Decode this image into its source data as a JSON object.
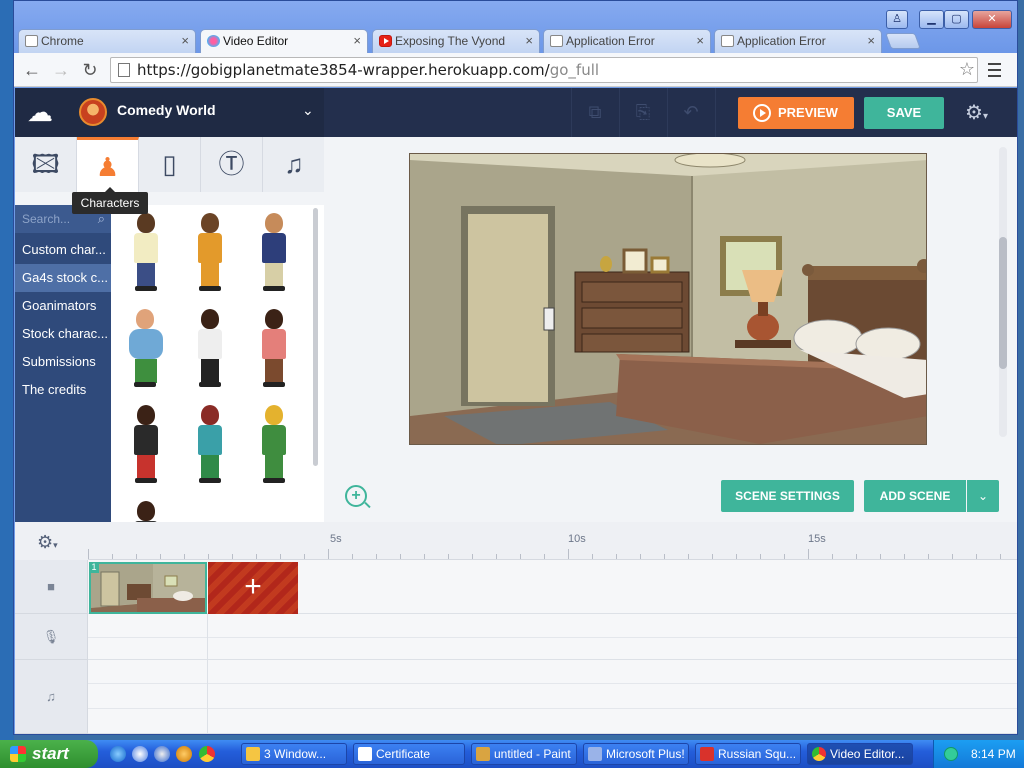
{
  "window_controls": {
    "user": "♙",
    "minimize": "▁",
    "maximize": "▢",
    "close": "✕"
  },
  "tabs": [
    {
      "label": "Chrome",
      "icon": "page-icon"
    },
    {
      "label": "Video Editor",
      "icon": "vyond-icon",
      "active": true
    },
    {
      "label": "Exposing The Vyond",
      "icon": "youtube-icon"
    },
    {
      "label": "Application Error",
      "icon": "page-icon"
    },
    {
      "label": "Application Error",
      "icon": "page-icon"
    }
  ],
  "tab_close": "×",
  "toolbar": {
    "back": "←",
    "forward": "→",
    "reload": "↻",
    "url_main": "https://gobigplanetmate3854-wrapper.herokuapp.com/",
    "url_dim": "go_full",
    "star": "☆"
  },
  "editor": {
    "upload_icon": "☁",
    "theme_name": "Comedy World",
    "theme_chevron": "⌄",
    "header_icons": [
      "⧉",
      "⎘",
      "↶"
    ],
    "preview_label": "PREVIEW",
    "save_label": "SAVE",
    "settings_icon": "⚙",
    "settings_caret": "▾"
  },
  "asset_tabs": [
    {
      "icon": "🖾",
      "name": "background"
    },
    {
      "icon": "♟",
      "name": "characters"
    },
    {
      "icon": "▯",
      "name": "props"
    },
    {
      "icon": "Ⓣ",
      "name": "text"
    },
    {
      "icon": "♫",
      "name": "music"
    }
  ],
  "tooltip": "Characters",
  "sidebar": {
    "search_placeholder": "Search...",
    "search_icon": "⌕",
    "items": [
      {
        "label": "Custom char..."
      },
      {
        "label": "Ga4s stock c...",
        "selected": true
      },
      {
        "label": "Goanimators"
      },
      {
        "label": "Stock charac..."
      },
      {
        "label": "Submissions"
      },
      {
        "label": "The credits"
      }
    ]
  },
  "stage": {
    "zoom_icon": "+",
    "scene_settings_label": "SCENE SETTINGS",
    "add_scene_label": "ADD SCENE",
    "add_scene_caret": "⌄"
  },
  "timeline": {
    "settings_icon": "⚙",
    "settings_caret": "▾",
    "ruler_labels": [
      "5s",
      "10s",
      "15s"
    ],
    "track_icons": {
      "video": "■",
      "voice": "🎙",
      "music": "♫"
    },
    "scene_number": "1",
    "add_clip_icon": "+"
  },
  "taskbar": {
    "start_label": "start",
    "tasks": [
      {
        "label": "3 Window...",
        "icon_color": "#f5c542"
      },
      {
        "label": "Certificate",
        "icon_color": "#ffffff"
      },
      {
        "label": "untitled - Paint",
        "icon_color": "#d9a441"
      },
      {
        "label": "Microsoft Plus!",
        "icon_color": "#9ab3e8"
      },
      {
        "label": "Russian Squ...",
        "icon_color": "#d9322b"
      },
      {
        "label": "Video Editor...",
        "icon_color": "#e9e9e9",
        "active": true
      }
    ],
    "clock": "8:14 PM"
  }
}
